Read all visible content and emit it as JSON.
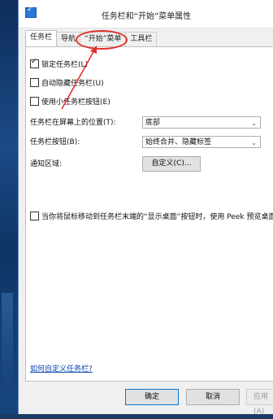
{
  "window": {
    "title": "任务栏和“开始”菜单属性"
  },
  "tabs": [
    {
      "label": "任务栏",
      "active": true
    },
    {
      "label": "导航",
      "active": false
    },
    {
      "label": "“开始”菜单",
      "active": false
    },
    {
      "label": "工具栏",
      "active": false
    }
  ],
  "options": {
    "lock_taskbar": {
      "label": "锁定任务栏(L)",
      "checked": true
    },
    "auto_hide": {
      "label": "自动隐藏任务栏(U)",
      "checked": false
    },
    "small_buttons": {
      "label": "使用小任务栏按钮(E)",
      "checked": false
    }
  },
  "position": {
    "label": "任务栏在屏幕上的位置(T):",
    "value": "底部"
  },
  "buttons": {
    "label": "任务栏按钮(B):",
    "value": "始终合并、隐藏标签"
  },
  "notify": {
    "label": "通知区域:",
    "button_label": "自定义(C)..."
  },
  "peek": {
    "label": "当你将鼠标移动到任务栏末端的“显示桌面”按钮时，使用 Peek 预览桌面",
    "checked": false
  },
  "help_link": "如何自定义任务栏?",
  "footer": {
    "ok": "确定",
    "cancel": "取消",
    "apply": "应用(A)"
  },
  "colors": {
    "annotation": "#e0302a",
    "link": "#0645ad"
  },
  "icons": {
    "title": "taskbar-properties-icon",
    "chevron": "chevron-down-icon"
  }
}
